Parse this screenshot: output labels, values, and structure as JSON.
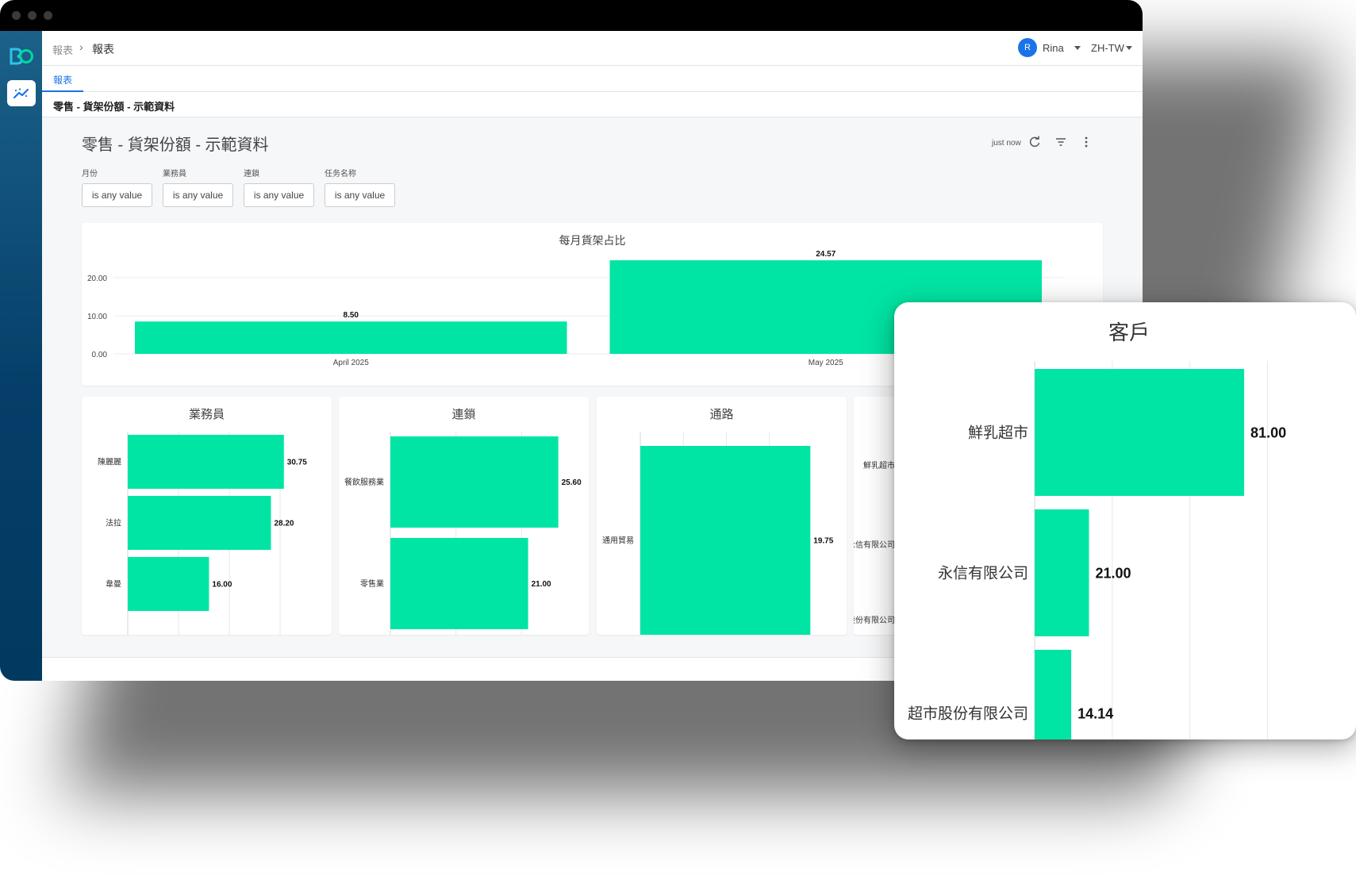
{
  "app": {
    "breadcrumb": {
      "root": "報表",
      "separator": "›",
      "current": "報表"
    },
    "user": {
      "initial": "R",
      "name": "Rina"
    },
    "language": "ZH-TW",
    "tab": "報表",
    "page_title": "零售 - 貨架份額 - 示範資料"
  },
  "dashboard": {
    "title": "零售 - 貨架份額 - 示範資料",
    "refresh_time": "just now",
    "icons": [
      "refresh-icon",
      "filter-icon",
      "more-vertical-icon"
    ],
    "filters": [
      {
        "label": "月份",
        "value": "is any value"
      },
      {
        "label": "業務員",
        "value": "is any value"
      },
      {
        "label": "連鎖",
        "value": "is any value"
      },
      {
        "label": "任务名称",
        "value": "is any value"
      }
    ]
  },
  "colors": {
    "bar": "#00e5a4",
    "accent": "#1a73e8",
    "sidebar": "#0a4a72"
  },
  "chart_data": [
    {
      "id": "monthly",
      "type": "bar",
      "title": "每月貨架占比",
      "categories": [
        "April 2025",
        "May 2025"
      ],
      "values": [
        8.5,
        24.57
      ],
      "value_labels": [
        "8.50",
        "24.57"
      ],
      "yticks": [
        "0.00",
        "10.00",
        "20.00"
      ],
      "ylim": [
        0,
        25
      ],
      "grid": true
    },
    {
      "id": "salesperson",
      "type": "bar",
      "orientation": "horizontal",
      "title": "業務員",
      "categories": [
        "陳麗麗",
        "法拉",
        "韋曼"
      ],
      "values": [
        30.75,
        28.2,
        16.0
      ],
      "value_labels": [
        "30.75",
        "28.20",
        "16.00"
      ],
      "xlim": [
        0,
        35
      ]
    },
    {
      "id": "chain",
      "type": "bar",
      "orientation": "horizontal",
      "title": "連鎖",
      "categories": [
        "餐飲服務業",
        "零售業"
      ],
      "values": [
        25.6,
        21.0
      ],
      "value_labels": [
        "25.60",
        "21.00"
      ],
      "xlim": [
        0,
        30
      ]
    },
    {
      "id": "channel",
      "type": "bar",
      "orientation": "horizontal",
      "title": "通路",
      "categories": [
        "通用貿易"
      ],
      "values": [
        19.75
      ],
      "value_labels": [
        "19.75"
      ],
      "xlim": [
        0,
        20
      ]
    },
    {
      "id": "customer",
      "type": "bar",
      "orientation": "horizontal",
      "title": "客戶",
      "categories": [
        "鮮乳超市",
        "永信有限公司",
        "超市股份有限公司"
      ],
      "values": [
        81.0,
        21.0,
        14.14
      ],
      "value_labels": [
        "81.00",
        "21.00",
        "14.14"
      ],
      "xlim": [
        0,
        100
      ]
    }
  ]
}
